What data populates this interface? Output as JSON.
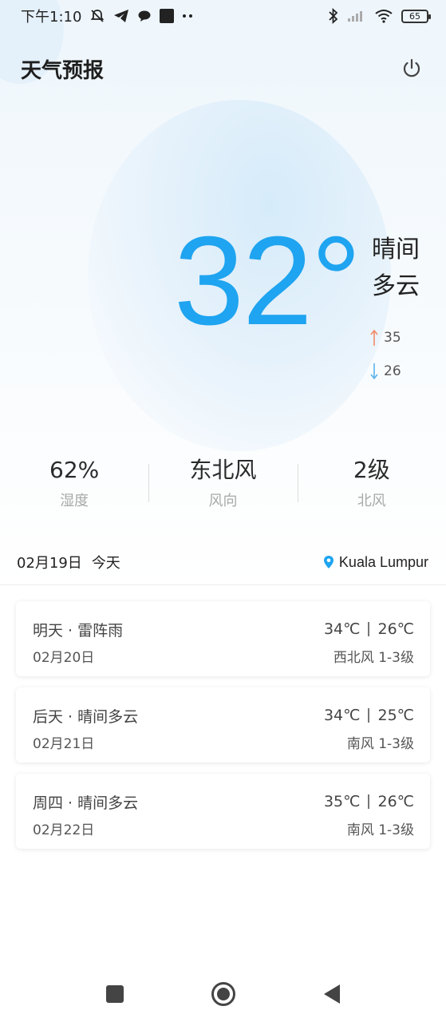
{
  "status_bar": {
    "time": "下午1:10",
    "battery": "65"
  },
  "header": {
    "title": "天气预报"
  },
  "current": {
    "temperature": "32°",
    "condition_line1": "晴间",
    "condition_line2": "多云",
    "high": "35",
    "low": "26"
  },
  "stats": [
    {
      "value": "62%",
      "label": "湿度"
    },
    {
      "value": "东北风",
      "label": "风向"
    },
    {
      "value": "2级",
      "label": "北风"
    }
  ],
  "date_row": {
    "date": "02月19日",
    "day": "今天",
    "location": "Kuala Lumpur"
  },
  "forecast": [
    {
      "title": "明天 · 雷阵雨",
      "high": "34℃",
      "low": "26℃",
      "date": "02月20日",
      "wind": "西北风 1-3级"
    },
    {
      "title": "后天 · 晴间多云",
      "high": "34℃",
      "low": "25℃",
      "date": "02月21日",
      "wind": "南风 1-3级"
    },
    {
      "title": "周四 · 晴间多云",
      "high": "35℃",
      "low": "26℃",
      "date": "02月22日",
      "wind": "南风 1-3级"
    }
  ],
  "colors": {
    "accent": "#1ea4f0",
    "high_arrow": "#f08a6a",
    "low_arrow": "#5ab4ea"
  }
}
